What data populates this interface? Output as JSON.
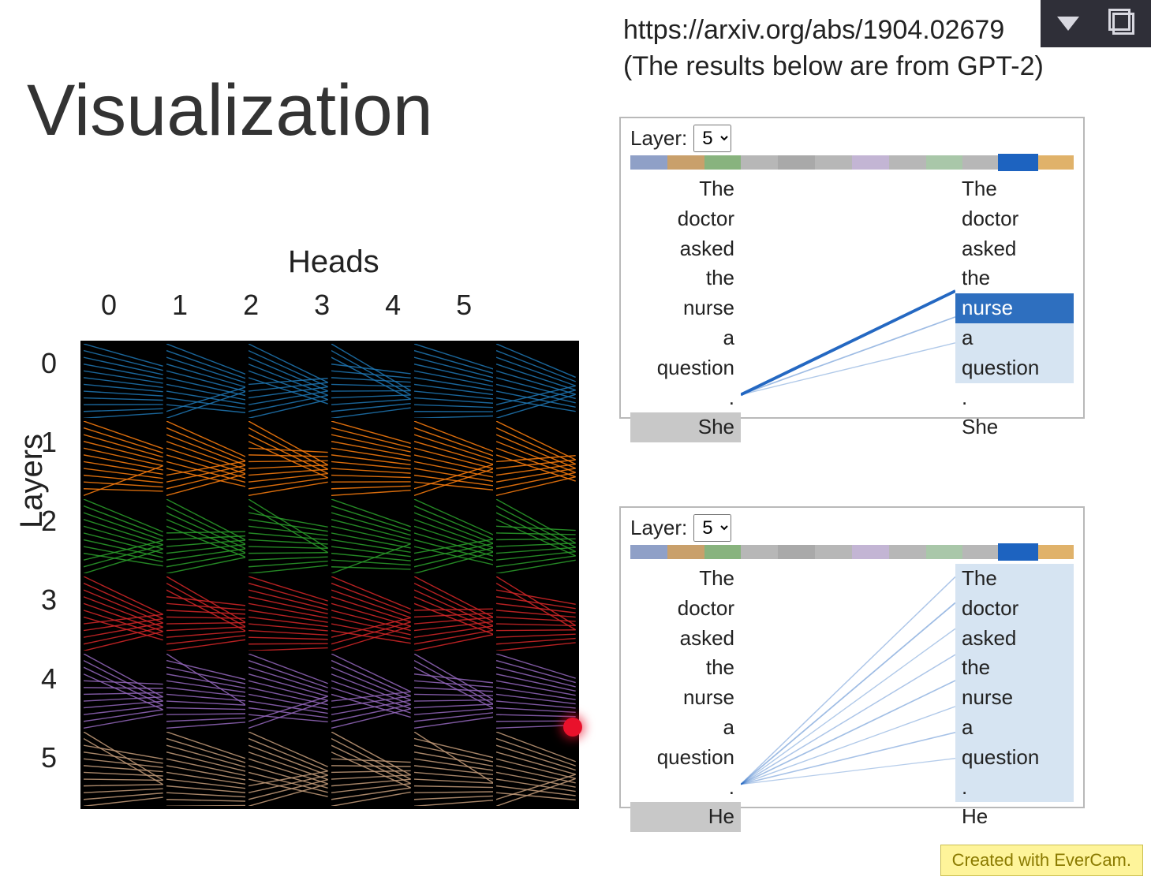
{
  "title": "Visualization",
  "source": {
    "url": "https://arxiv.org/abs/1904.02679",
    "note": "(The results below are from GPT-2)"
  },
  "heads_grid": {
    "column_title": "Heads",
    "row_title": "Layers",
    "columns": [
      "0",
      "1",
      "2",
      "3",
      "4",
      "5"
    ],
    "rows": [
      "0",
      "1",
      "2",
      "3",
      "4",
      "5"
    ],
    "row_colors": [
      "#1f77b4",
      "#ff7f0e",
      "#2ca02c",
      "#d62728",
      "#9467bd",
      "#c49c7a"
    ]
  },
  "panel_top": {
    "layer_label": "Layer:",
    "layer_value": "5",
    "head_colors": [
      "#8fa0c7",
      "#c9a06b",
      "#88b37e",
      "#b7b7b7",
      "#a9a9a9",
      "#b7b7b7",
      "#c3b5d4",
      "#b7b7b7",
      "#a9c7a9",
      "#b7b7b7",
      "#1d63c0",
      "#e0b26a"
    ],
    "selected_head_index": 10,
    "left_tokens": [
      "The",
      "doctor",
      "asked",
      "the",
      "nurse",
      "a",
      "question",
      ".",
      "She"
    ],
    "right_tokens": [
      "The",
      "doctor",
      "asked",
      "the",
      "nurse",
      "a",
      "question",
      ".",
      "She"
    ],
    "left_highlight_index": 8,
    "right_strong_index": 4,
    "right_light_indices": [
      5,
      6
    ],
    "attn_weights_from_8": {
      "4": 0.72,
      "5": 0.18,
      "6": 0.1
    },
    "line_color": "#1d63c0"
  },
  "panel_bottom": {
    "layer_label": "Layer:",
    "layer_value": "5",
    "head_colors": [
      "#8fa0c7",
      "#c9a06b",
      "#88b37e",
      "#b7b7b7",
      "#a9a9a9",
      "#b7b7b7",
      "#c3b5d4",
      "#b7b7b7",
      "#a9c7a9",
      "#b7b7b7",
      "#1d63c0",
      "#e0b26a"
    ],
    "selected_head_index": 10,
    "left_tokens": [
      "The",
      "doctor",
      "asked",
      "the",
      "nurse",
      "a",
      "question",
      ".",
      "He"
    ],
    "right_tokens": [
      "The",
      "doctor",
      "asked",
      "the",
      "nurse",
      "a",
      "question",
      ".",
      "He"
    ],
    "left_highlight_index": 8,
    "right_light_indices": [
      0,
      1,
      2,
      3,
      4,
      5,
      6,
      7
    ],
    "attn_weights_from_8": {
      "0": 0.12,
      "1": 0.18,
      "2": 0.1,
      "3": 0.12,
      "4": 0.16,
      "5": 0.1,
      "6": 0.14,
      "7": 0.08
    },
    "line_color": "#1d63c0"
  },
  "watermark": "Created with EverCam."
}
